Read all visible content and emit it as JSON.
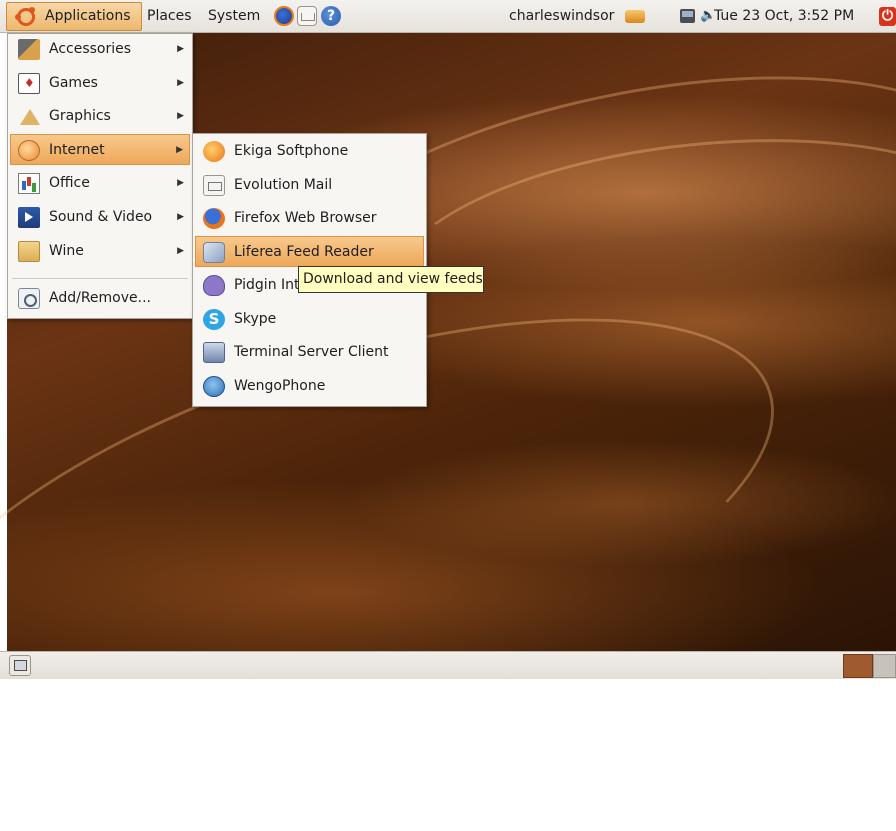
{
  "top_panel": {
    "menus": {
      "applications": "Applications",
      "places": "Places",
      "system": "System"
    },
    "launchers": [
      "firefox-icon",
      "mail-icon",
      "help-icon"
    ],
    "user_name": "charleswindsor",
    "clock": "Tue 23 Oct,  3:52 PM",
    "icons": {
      "network": "network-icon",
      "volume": "volume-icon",
      "power": "power-icon"
    }
  },
  "applications_menu": {
    "items": [
      {
        "label": "Accessories",
        "icon": "accessories-icon",
        "submenu": true
      },
      {
        "label": "Games",
        "icon": "games-icon",
        "submenu": true
      },
      {
        "label": "Graphics",
        "icon": "graphics-icon",
        "submenu": true
      },
      {
        "label": "Internet",
        "icon": "internet-icon",
        "submenu": true,
        "highlighted": true
      },
      {
        "label": "Office",
        "icon": "office-icon",
        "submenu": true
      },
      {
        "label": "Sound & Video",
        "icon": "sound-video-icon",
        "submenu": true
      },
      {
        "label": "Wine",
        "icon": "wine-icon",
        "submenu": true
      },
      {
        "label": "Add/Remove...",
        "icon": "add-remove-icon",
        "submenu": false
      }
    ],
    "arrow_glyph": "▶"
  },
  "internet_submenu": {
    "items": [
      {
        "label": "Ekiga Softphone",
        "icon": "ekiga-icon"
      },
      {
        "label": "Evolution Mail",
        "icon": "evolution-icon"
      },
      {
        "label": "Firefox Web Browser",
        "icon": "firefox-icon"
      },
      {
        "label": "Liferea Feed Reader",
        "icon": "liferea-icon",
        "highlighted": true
      },
      {
        "label": "Pidgin Internet Messenger",
        "icon": "pidgin-icon"
      },
      {
        "label": "Skype",
        "icon": "skype-icon"
      },
      {
        "label": "Terminal Server Client",
        "icon": "tsclient-icon"
      },
      {
        "label": "WengoPhone",
        "icon": "wengophone-icon"
      }
    ]
  },
  "tooltip": {
    "text": "Download and view feeds"
  },
  "colors": {
    "menu_highlight": "#eea85a",
    "desktop_brown": "#6b3414",
    "tooltip_bg": "#ffffbf",
    "workspace_active": "#a05a30"
  }
}
